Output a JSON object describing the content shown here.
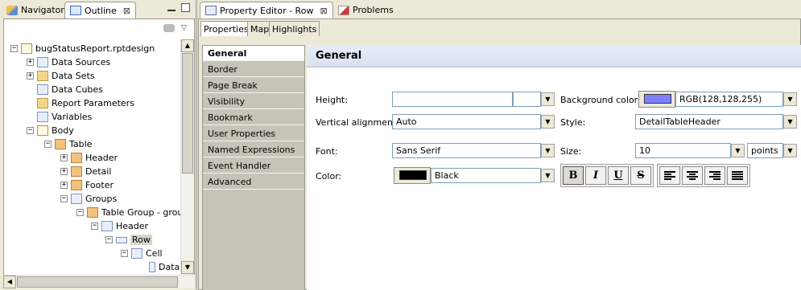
{
  "left_view": {
    "tabs": [
      {
        "label": "Navigator",
        "active": false
      },
      {
        "label": "Outline",
        "active": true
      }
    ],
    "close_symbol": "⊠",
    "tree": [
      {
        "label": "bugStatusReport.rptdesign",
        "expander": "−",
        "icon": "report-design-icon"
      },
      {
        "label": "Data Sources",
        "expander": "+",
        "icon": "data-sources-icon"
      },
      {
        "label": "Data Sets",
        "expander": "+",
        "icon": "data-sets-icon"
      },
      {
        "label": "Data Cubes",
        "expander": "",
        "icon": "data-cubes-icon"
      },
      {
        "label": "Report Parameters",
        "expander": "",
        "icon": "report-parameters-icon"
      },
      {
        "label": "Variables",
        "expander": "",
        "icon": "variables-icon"
      },
      {
        "label": "Body",
        "expander": "−",
        "icon": "body-icon"
      },
      {
        "label": "Table",
        "expander": "−",
        "icon": "table-icon"
      },
      {
        "label": "Header",
        "expander": "+",
        "icon": "table-header-icon"
      },
      {
        "label": "Detail",
        "expander": "+",
        "icon": "table-detail-icon"
      },
      {
        "label": "Footer",
        "expander": "+",
        "icon": "table-footer-icon"
      },
      {
        "label": "Groups",
        "expander": "−",
        "icon": "groups-icon"
      },
      {
        "label": "Table Group - groupE",
        "expander": "−",
        "icon": "table-group-icon"
      },
      {
        "label": "Header",
        "expander": "−",
        "icon": "group-header-icon"
      },
      {
        "label": "Row",
        "expander": "−",
        "icon": "row-icon",
        "selected": true
      },
      {
        "label": "Cell",
        "expander": "−",
        "icon": "cell-icon"
      },
      {
        "label": "Data",
        "expander": "",
        "icon": "data-item-icon"
      }
    ]
  },
  "right_view": {
    "tabs": [
      {
        "label": "Property Editor - Row",
        "active": true
      },
      {
        "label": "Problems",
        "active": false
      }
    ],
    "subtabs": [
      "Properties",
      "Map",
      "Highlights"
    ],
    "categories": [
      "General",
      "Border",
      "Page Break",
      "Visibility",
      "Bookmark",
      "User Properties",
      "Named Expressions",
      "Event Handler",
      "Advanced"
    ],
    "section_title": "General",
    "fields": {
      "height_label": "Height:",
      "height_value": "",
      "background_color_label": "Background color:",
      "background_color_value": "RGB(128,128,255)",
      "background_color_hex": "#8080ff",
      "vertical_alignment_label": "Vertical alignment:",
      "vertical_alignment_value": "Auto",
      "style_label": "Style:",
      "style_value": "DetailTableHeader",
      "font_label": "Font:",
      "font_value": "Sans Serif",
      "size_label": "Size:",
      "size_value": "10",
      "size_unit": "points",
      "color_label": "Color:",
      "color_value": "Black",
      "color_hex": "#000000"
    },
    "format_buttons": [
      {
        "glyph": "B",
        "name": "bold",
        "pressed": true
      },
      {
        "glyph": "I",
        "name": "italic",
        "pressed": false
      },
      {
        "glyph": "U",
        "name": "underline",
        "pressed": false
      },
      {
        "glyph": "S",
        "name": "strikethrough",
        "pressed": false
      }
    ],
    "align_buttons": [
      "align-left",
      "align-center",
      "align-right",
      "align-justify"
    ]
  }
}
